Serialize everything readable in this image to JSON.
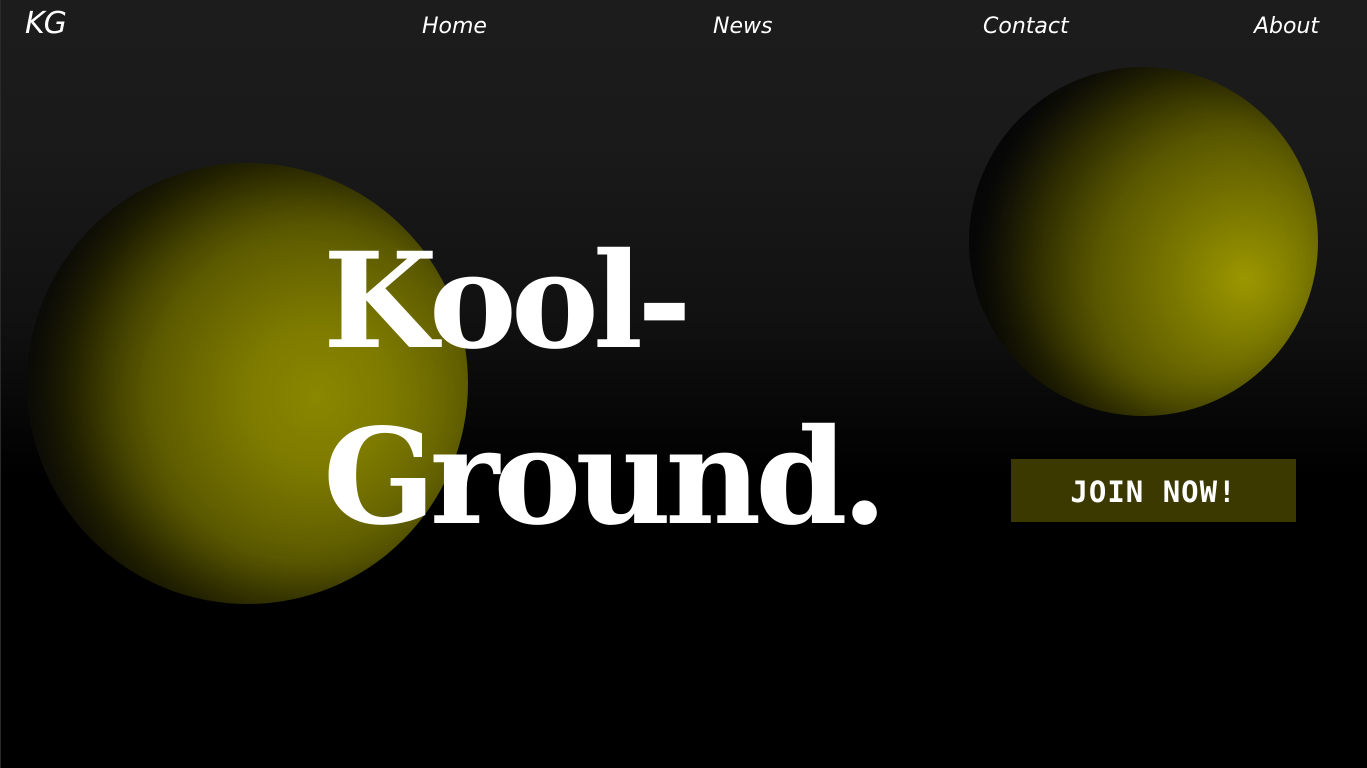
{
  "header": {
    "logo": "KG",
    "nav": [
      {
        "label": "Home"
      },
      {
        "label": "News"
      },
      {
        "label": "Contact"
      },
      {
        "label": "About"
      }
    ]
  },
  "hero": {
    "title_line_1": "Kool-",
    "title_line_2": "Ground.",
    "cta_label": "JOIN NOW!"
  },
  "colors": {
    "background": "#000000",
    "accent_olive": "#8a8700",
    "button_background": "#3b3800",
    "text": "#ffffff"
  }
}
